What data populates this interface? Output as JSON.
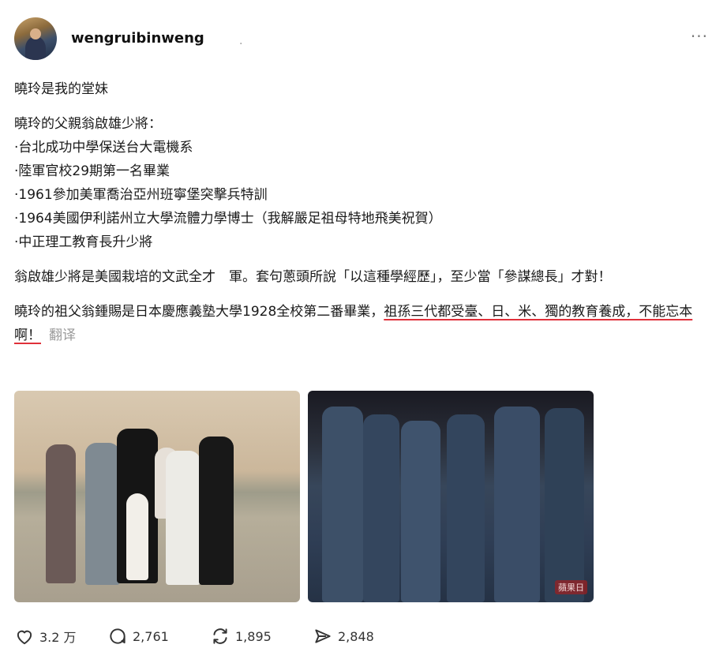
{
  "post": {
    "username": "wengruibinweng",
    "dot": ".",
    "more_label": "···",
    "lines_a": [
      "曉玲是我的堂妹"
    ],
    "lines_b": [
      "曉玲的父親翁啟雄少將：",
      "·台北成功中學保送台大電機系",
      "·陸軍官校29期第一名畢業",
      "·1961參加美軍喬治亞州班寧堡突擊兵特訓",
      "·1964美國伊利諾州立大學流體力學博士（我解嚴足祖母特地飛美祝賀）",
      "·中正理工教育長升少將"
    ],
    "para_c": "翁啟雄少將是美國栽培的文武全才　軍。套句蔥頭所說「以這種學經歷」，至少當「參謀總長」才對！",
    "para_d_plain": "曉玲的祖父翁鍾賜是日本慶應義塾大學1928全校第二番畢業，",
    "para_d_highlight": "祖孫三代都受臺、日、米、獨的教育養成，不能忘本啊！",
    "translate_label": "翻译",
    "photo_stamp": "蘋果日"
  },
  "actions": {
    "likes": "3.2 万",
    "comments": "2,761",
    "reposts": "1,895",
    "shares": "2,848"
  }
}
